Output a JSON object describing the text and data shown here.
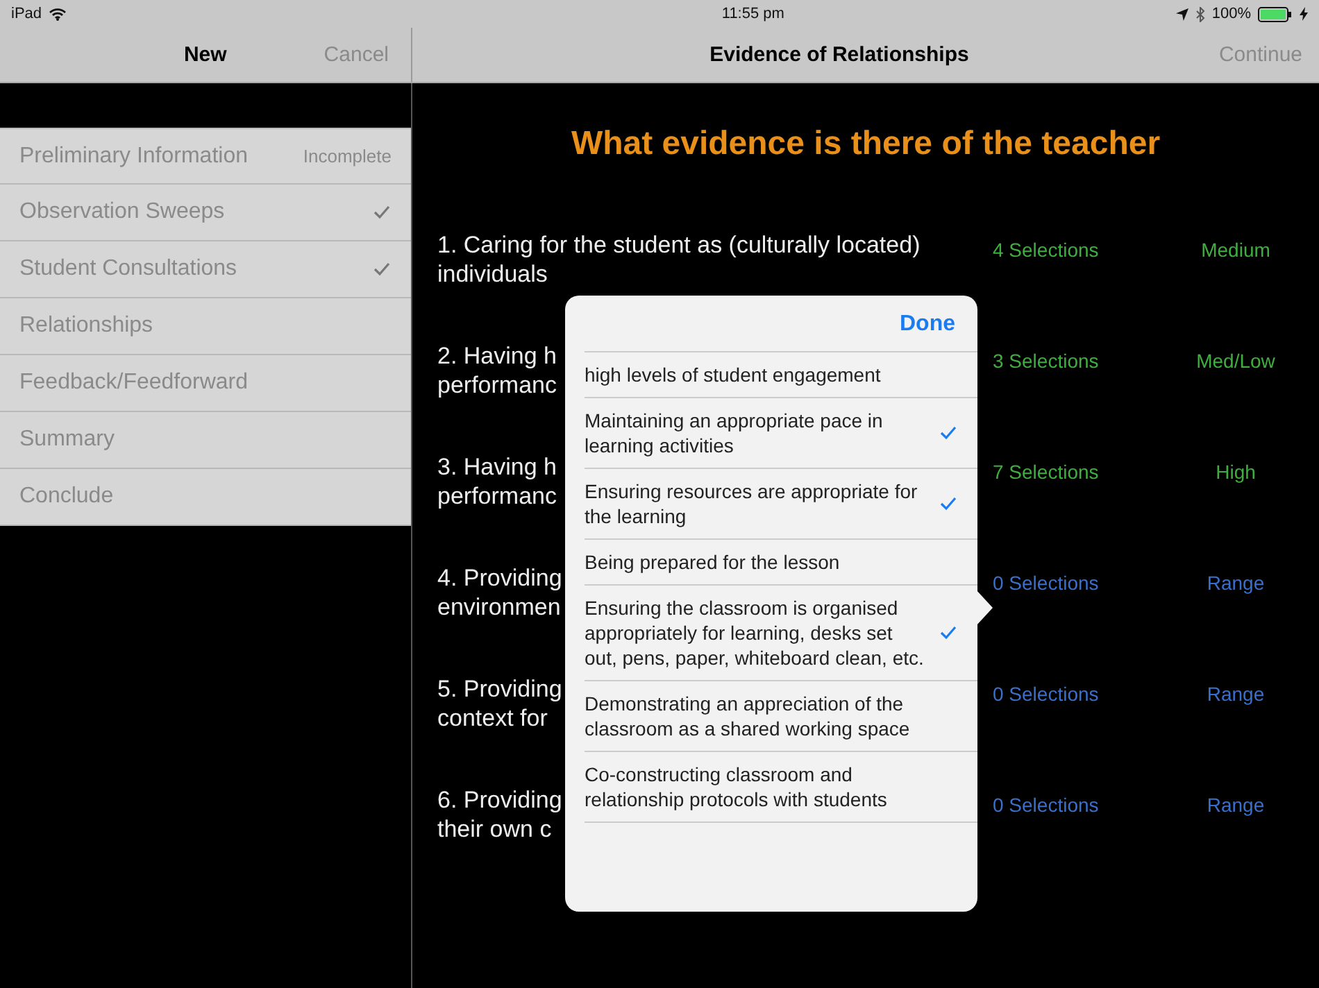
{
  "status_bar": {
    "device": "iPad",
    "time": "11:55 pm",
    "battery": "100%"
  },
  "left_nav": {
    "title": "New",
    "cancel": "Cancel"
  },
  "right_nav": {
    "title": "Evidence of Relationships",
    "continue": "Continue"
  },
  "sidebar": {
    "items": [
      {
        "label": "Preliminary Information",
        "status": "Incomplete",
        "checked": false
      },
      {
        "label": "Observation Sweeps",
        "checked": true
      },
      {
        "label": "Student Consultations",
        "checked": true
      },
      {
        "label": "Relationships",
        "checked": false
      },
      {
        "label": "Feedback/Feedforward",
        "checked": false
      },
      {
        "label": "Summary",
        "checked": false
      },
      {
        "label": "Conclude",
        "checked": false
      }
    ]
  },
  "heading": "What evidence is there of the teacher",
  "criteria": [
    {
      "lines": [
        "1. Caring for the student as (culturally located)",
        "individuals"
      ],
      "selections": "4 Selections",
      "rating": "Medium",
      "color": "#3fae3f"
    },
    {
      "lines": [
        "2. Having h",
        "performanc"
      ],
      "selections": "3 Selections",
      "rating": "Med/Low",
      "color": "#3fae3f"
    },
    {
      "lines": [
        "3. Having h",
        "performanc"
      ],
      "selections": "7 Selections",
      "rating": "High",
      "color": "#3fae3f"
    },
    {
      "lines": [
        "4. Providing",
        "environmen"
      ],
      "selections": "0 Selections",
      "rating": "Range",
      "color": "#3b6fcc"
    },
    {
      "lines": [
        "5. Providing",
        "context for"
      ],
      "selections": "0 Selections",
      "rating": "Range",
      "color": "#3b6fcc"
    },
    {
      "lines": [
        "6. Providing",
        "their own c"
      ],
      "selections": "0 Selections",
      "rating": "Range",
      "color": "#3b6fcc"
    }
  ],
  "popover": {
    "done": "Done",
    "options": [
      {
        "label": "high levels of student engagement",
        "checked": false
      },
      {
        "label": "Maintaining an appropriate pace in learning activities",
        "checked": true
      },
      {
        "label": "Ensuring resources are appropriate for the learning",
        "checked": true
      },
      {
        "label": "Being prepared for the lesson",
        "checked": false
      },
      {
        "label": "Ensuring the classroom is organised appropriately for learning, desks set out, pens, paper, whiteboard clean, etc.",
        "checked": true
      },
      {
        "label": "Demonstrating an appreciation of the classroom as a shared working space",
        "checked": false
      },
      {
        "label": "Co-constructing classroom and relationship protocols with students",
        "checked": false
      }
    ]
  }
}
